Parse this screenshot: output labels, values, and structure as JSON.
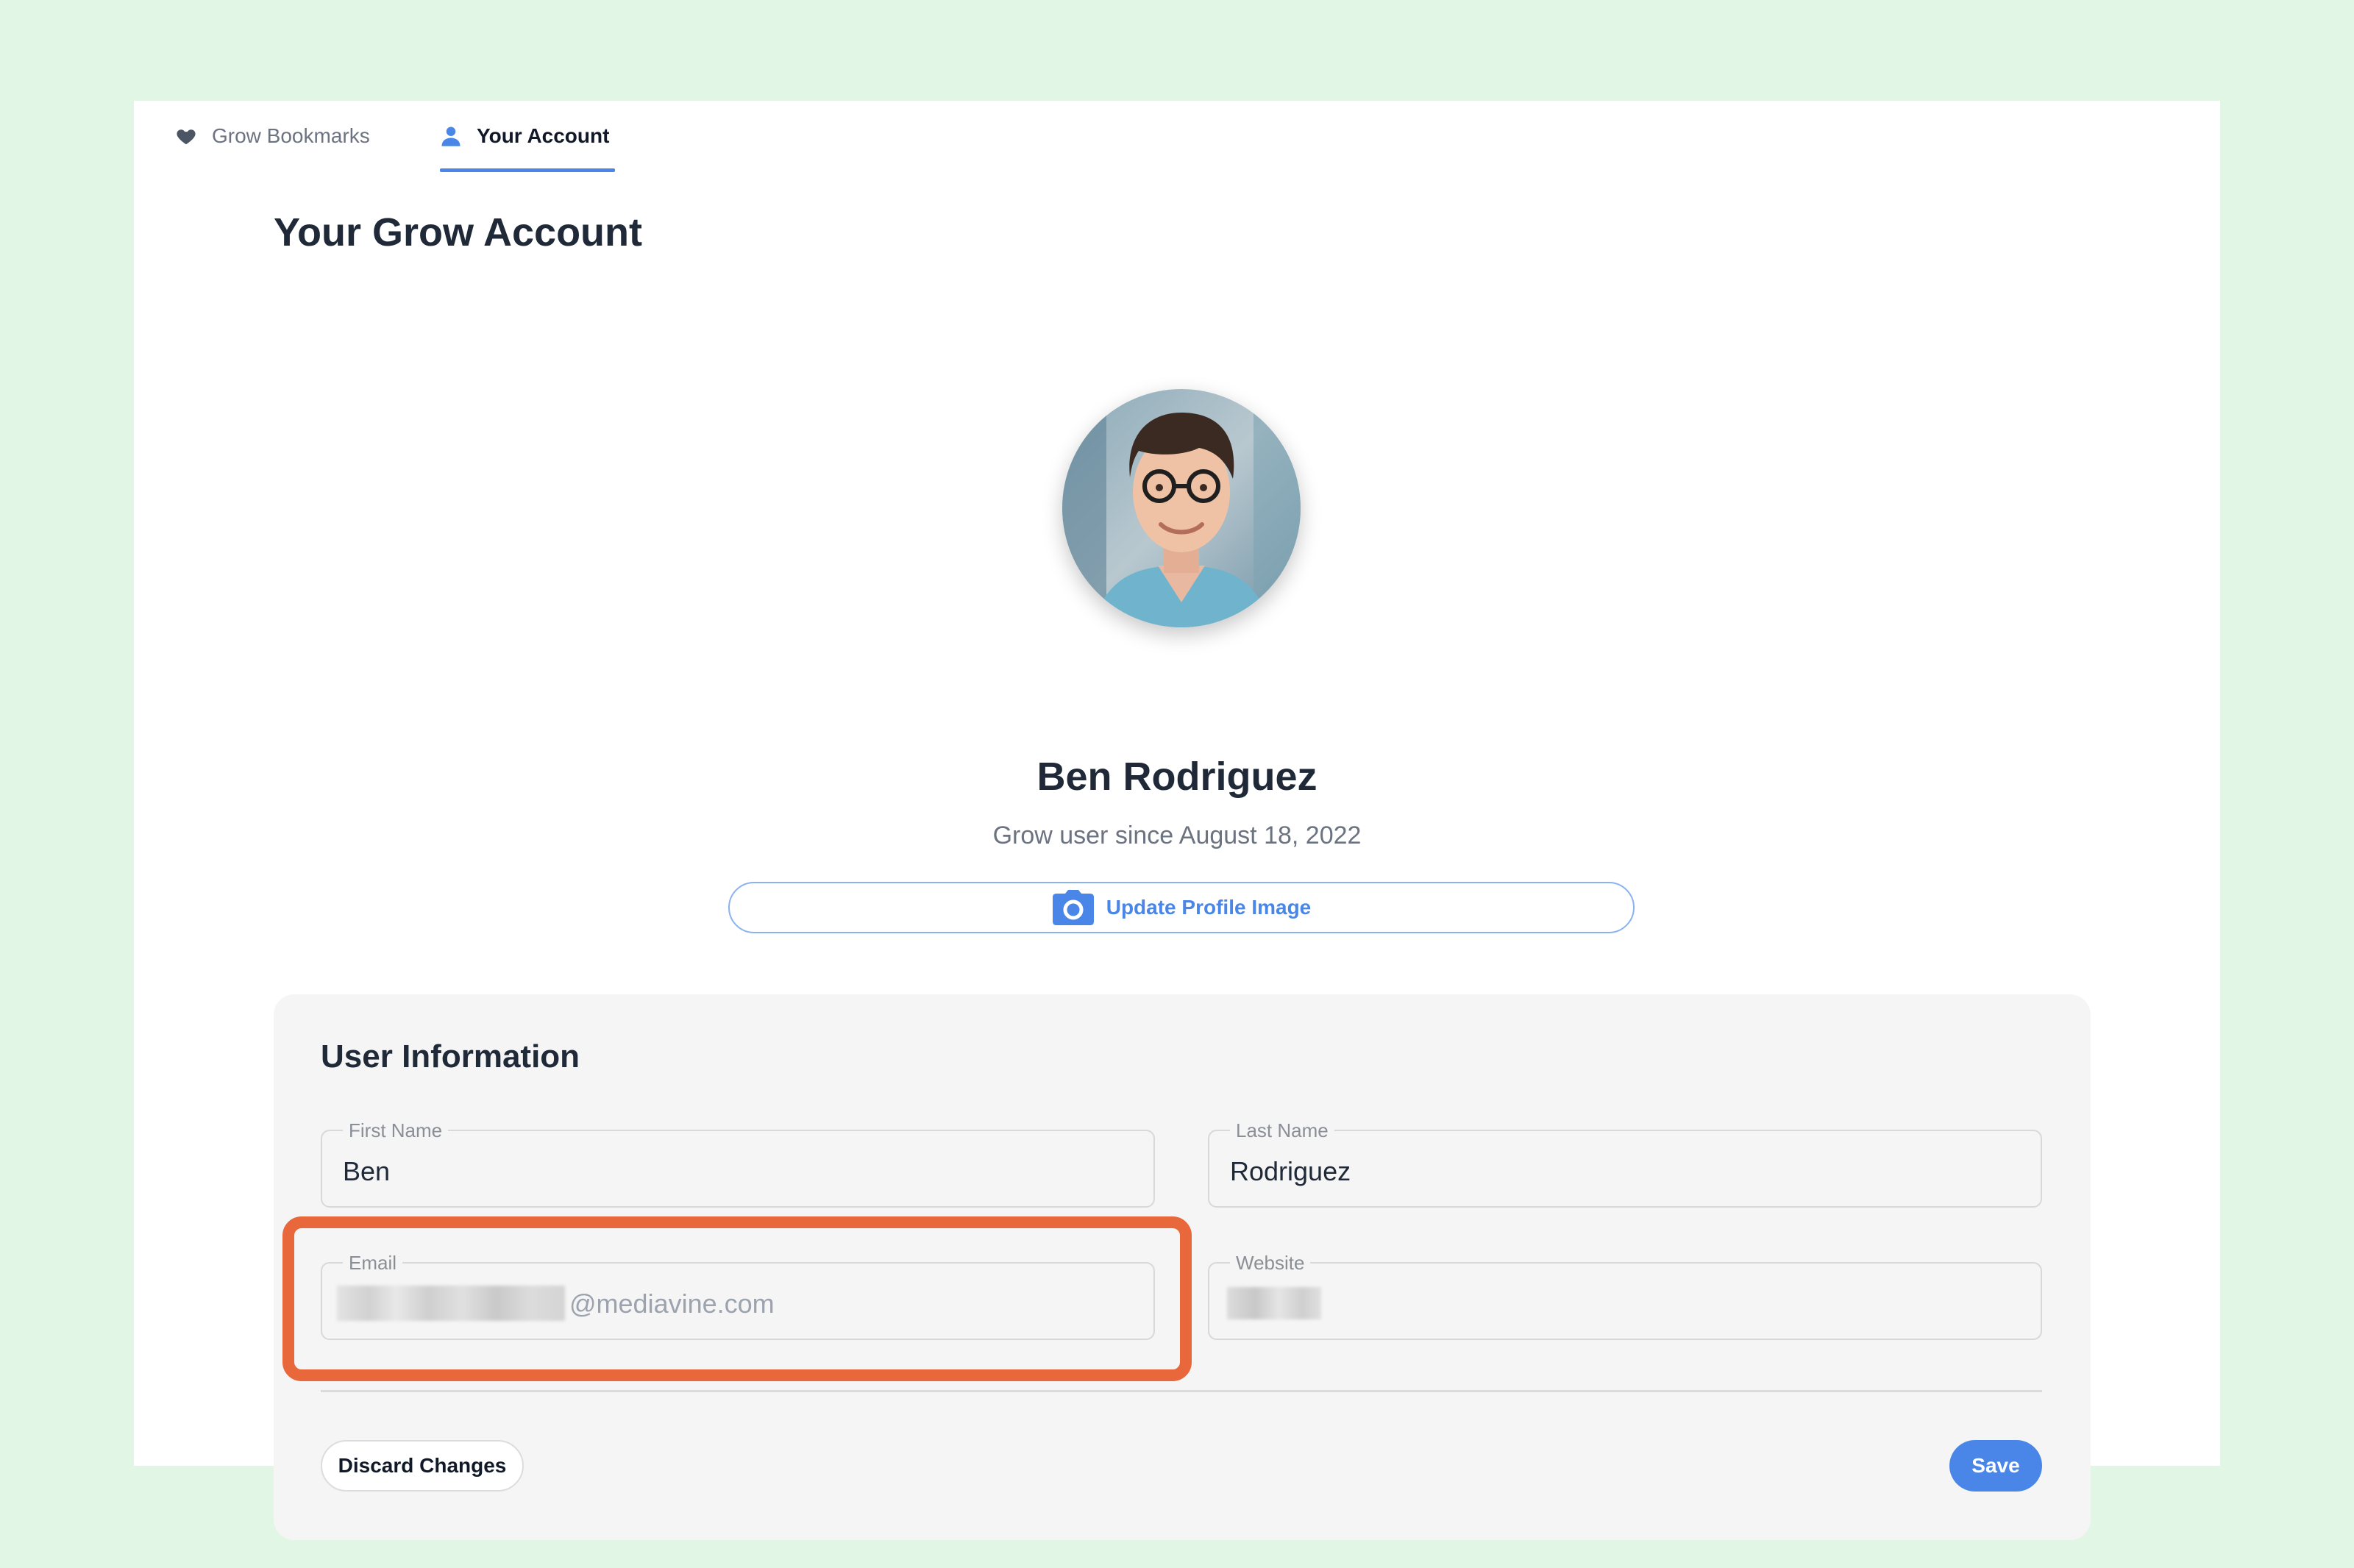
{
  "tabs": [
    {
      "label": "Grow Bookmarks",
      "icon": "heart-icon",
      "active": false
    },
    {
      "label": "Your Account",
      "icon": "user-icon",
      "active": true
    }
  ],
  "page": {
    "title": "Your Grow Account"
  },
  "profile": {
    "name": "Ben Rodriguez",
    "member_since": "Grow user since August 18, 2022",
    "update_image_label": "Update Profile Image"
  },
  "user_info": {
    "title": "User Information",
    "first_name": {
      "label": "First Name",
      "value": "Ben"
    },
    "last_name": {
      "label": "Last Name",
      "value": "Rodriguez"
    },
    "email": {
      "label": "Email",
      "value_visible": "@mediavine.com"
    },
    "website": {
      "label": "Website"
    }
  },
  "actions": {
    "discard_label": "Discard Changes",
    "save_label": "Save"
  },
  "colors": {
    "accent": "#4a86e8",
    "highlight": "#e8673b",
    "background": "#e2f6e5"
  }
}
